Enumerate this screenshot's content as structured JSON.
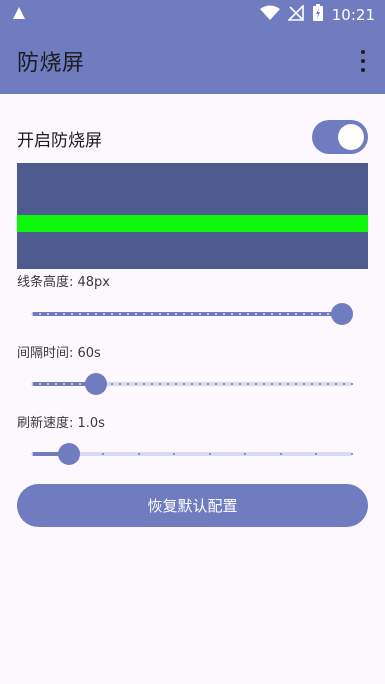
{
  "status_bar": {
    "time": "10:21"
  },
  "app_bar": {
    "title": "防烧屏"
  },
  "main": {
    "toggle_label": "开启防烧屏",
    "toggle_on": true,
    "colors": {
      "accent": "#6f7cc0",
      "preview_bg": "#4e5b8e",
      "line": "#0df70d"
    },
    "settings": [
      {
        "label": "线条高度: 48px",
        "fraction": 0.97,
        "steps": 40
      },
      {
        "label": "间隔时间: 60s",
        "fraction": 0.2,
        "steps": 40
      },
      {
        "label": "刷新速度: 1.0s",
        "fraction": 0.115,
        "steps": 9
      }
    ],
    "reset_label": "恢复默认配置"
  }
}
